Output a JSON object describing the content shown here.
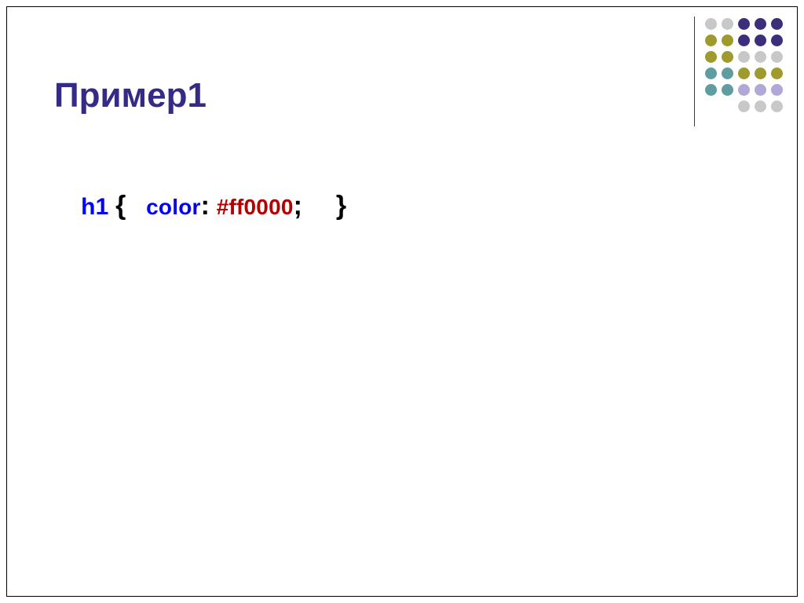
{
  "slide": {
    "title": "Пример1",
    "code": {
      "selector": "h1",
      "brace_open": "{",
      "property": "color",
      "colon": ":",
      "value": "#ff0000",
      "semicolon": ";",
      "brace_close": "}"
    }
  },
  "decor": {
    "colors": {
      "purple": "#3c2e7a",
      "olive": "#9e9a2e",
      "grey": "#c8c8c8",
      "teal": "#5f9ea0",
      "lavender": "#b0a8d6"
    }
  }
}
